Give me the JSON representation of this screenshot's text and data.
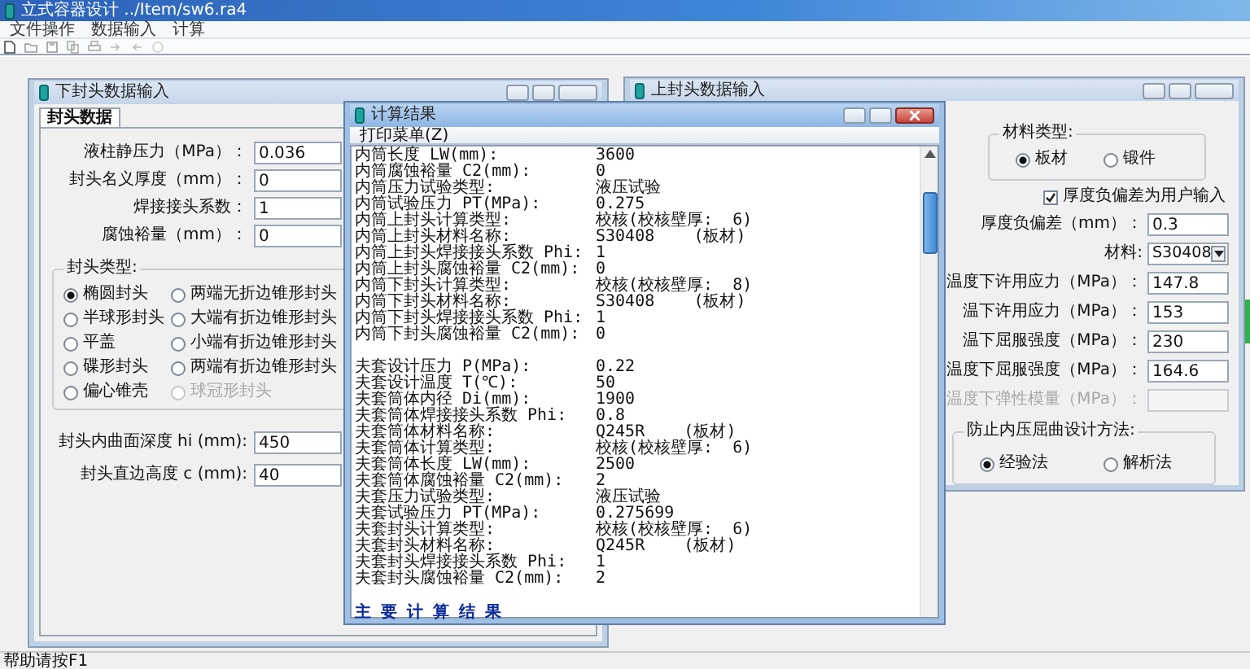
{
  "app": {
    "title": "立式容器设计 ../Item/sw6.ra4",
    "menu": [
      "文件操作",
      "数据输入",
      "计算"
    ],
    "status": "帮助请按F1"
  },
  "lower_head_window": {
    "title": "下封头数据输入",
    "tab": {
      "label": "封头数据",
      "selected": true
    },
    "fields": [
      {
        "label": "液柱静压力（MPa）：",
        "value": "0.036"
      },
      {
        "label": "封头名义厚度（mm）：",
        "value": "0"
      },
      {
        "label": "焊接接头系数：",
        "value": "1"
      },
      {
        "label": "腐蚀裕量（mm）：",
        "value": "0"
      }
    ],
    "head_type": {
      "label": "封头类型:",
      "options": [
        {
          "label": "椭圆封头",
          "selected": true,
          "disabled": false
        },
        {
          "label": "两端无折边锥形封头",
          "selected": false,
          "disabled": false
        },
        {
          "label": "半球形封头",
          "selected": false,
          "disabled": false
        },
        {
          "label": "大端有折边锥形封头",
          "selected": false,
          "disabled": false
        },
        {
          "label": "平盖",
          "selected": false,
          "disabled": false
        },
        {
          "label": "小端有折边锥形封头",
          "selected": false,
          "disabled": false
        },
        {
          "label": "碟形封头",
          "selected": false,
          "disabled": false
        },
        {
          "label": "两端有折边锥形封头",
          "selected": false,
          "disabled": false
        },
        {
          "label": "偏心锥壳",
          "selected": false,
          "disabled": false
        },
        {
          "label": "球冠形封头",
          "selected": false,
          "disabled": true
        }
      ]
    },
    "more_fields": [
      {
        "label": "封头内曲面深度 hi (mm):",
        "value": "450"
      },
      {
        "label": "封头直边高度 c (mm):",
        "value": "40"
      }
    ]
  },
  "result_window": {
    "title": "计算结果",
    "menu": [
      "打印菜单(Z)"
    ],
    "lines": [
      {
        "kind": "pair",
        "label": "内筒长度 LW(mm):",
        "value": "3600"
      },
      {
        "kind": "pair",
        "label": "内筒腐蚀裕量 C2(mm):",
        "value": "0"
      },
      {
        "kind": "pair",
        "label": "内筒压力试验类型:",
        "value": "液压试验"
      },
      {
        "kind": "pair",
        "label": "内筒试验压力 PT(MPa):",
        "value": "0.275"
      },
      {
        "kind": "pair",
        "label": "内筒上封头计算类型:",
        "value": "校核(校核壁厚:  6)"
      },
      {
        "kind": "pair",
        "label": "内筒上封头材料名称:",
        "value": "S30408    (板材)"
      },
      {
        "kind": "pair",
        "label": "内筒上封头焊接接头系数 Phi:",
        "value": "1"
      },
      {
        "kind": "pair",
        "label": "内筒上封头腐蚀裕量 C2(mm):",
        "value": "0"
      },
      {
        "kind": "pair",
        "label": "内筒下封头计算类型:",
        "value": "校核(校核壁厚:  8)"
      },
      {
        "kind": "pair",
        "label": "内筒下封头材料名称:",
        "value": "S30408    (板材)"
      },
      {
        "kind": "pair",
        "label": "内筒下封头焊接接头系数 Phi:",
        "value": "1"
      },
      {
        "kind": "pair",
        "label": "内筒下封头腐蚀裕量 C2(mm):",
        "value": "0"
      },
      {
        "kind": "blank"
      },
      {
        "kind": "pair",
        "label": "夫套设计压力 P(MPa):",
        "value": "0.22"
      },
      {
        "kind": "pair",
        "label": "夫套设计温度 T(℃):",
        "value": "50"
      },
      {
        "kind": "pair",
        "label": "夫套筒体内径 Di(mm):",
        "value": "1900"
      },
      {
        "kind": "pair",
        "label": "夫套筒体焊接接头系数 Phi:",
        "value": "0.8"
      },
      {
        "kind": "pair",
        "label": "夫套筒体材料名称:",
        "value": "Q245R    (板材)"
      },
      {
        "kind": "pair",
        "label": "夫套筒体计算类型:",
        "value": "校核(校核壁厚:  6)"
      },
      {
        "kind": "pair",
        "label": "夫套筒体长度 LW(mm):",
        "value": "2500"
      },
      {
        "kind": "pair",
        "label": "夫套筒体腐蚀裕量 C2(mm):",
        "value": "2"
      },
      {
        "kind": "pair",
        "label": "夫套压力试验类型:",
        "value": "液压试验"
      },
      {
        "kind": "pair",
        "label": "夫套试验压力 PT(MPa):",
        "value": "0.275699"
      },
      {
        "kind": "pair",
        "label": "夫套封头计算类型:",
        "value": "校核(校核壁厚:  6)"
      },
      {
        "kind": "pair",
        "label": "夫套封头材料名称:",
        "value": "Q245R    (板材)"
      },
      {
        "kind": "pair",
        "label": "夫套封头焊接接头系数 Phi:",
        "value": "1"
      },
      {
        "kind": "pair",
        "label": "夫套封头腐蚀裕量 C2(mm):",
        "value": "2"
      },
      {
        "kind": "blank"
      },
      {
        "kind": "heading",
        "text": "主 要 计 算 结 果"
      }
    ]
  },
  "upper_head_window": {
    "title": "上封头数据输入",
    "material_type": {
      "label": "材料类型:",
      "options": [
        {
          "label": "板材",
          "selected": true
        },
        {
          "label": "锻件",
          "selected": false
        }
      ]
    },
    "checkbox": {
      "label": "厚度负偏差为用户输入",
      "checked": true
    },
    "fields": [
      {
        "kind": "input",
        "label": "厚度负偏差（mm）：",
        "value": "0.3",
        "disabled": false
      },
      {
        "kind": "select",
        "label": "材料:",
        "value": "S30408",
        "disabled": false
      },
      {
        "kind": "input",
        "label": "温度下许用应力（MPa）：",
        "value": "147.8",
        "disabled": false
      },
      {
        "kind": "input",
        "label": "温下许用应力（MPa）：",
        "value": "153",
        "disabled": false
      },
      {
        "kind": "input",
        "label": "温下屈服强度（MPa）：",
        "value": "230",
        "disabled": false
      },
      {
        "kind": "input",
        "label": "温度下屈服强度（MPa）：",
        "value": "164.6",
        "disabled": false
      },
      {
        "kind": "input",
        "label": "温度下弹性模量（MPa）：",
        "disabled": true
      }
    ],
    "buckling": {
      "label": "防止内压屈曲设计方法:",
      "options": [
        {
          "label": "经验法",
          "selected": true
        },
        {
          "label": "解析法",
          "selected": false
        }
      ]
    }
  }
}
